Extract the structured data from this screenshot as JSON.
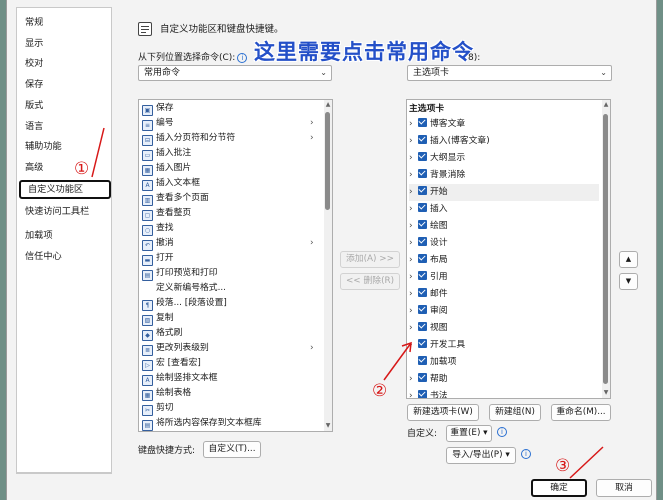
{
  "nav": {
    "items": [
      "常规",
      "显示",
      "校对",
      "保存",
      "版式",
      "语言",
      "辅助功能",
      "高级",
      "自定义功能区",
      "快速访问工具栏",
      "加载项",
      "信任中心"
    ],
    "selected_index": 8
  },
  "header": {
    "title": "自定义功能区和键盘快捷键。"
  },
  "annotation": {
    "banner": "这里需要点击常用命令",
    "mark1": "①",
    "mark2": "②",
    "mark3": "③",
    "color": "#d71818"
  },
  "left": {
    "label": "从下列位置选择命令(C):",
    "combo_value": "常用命令",
    "commands": [
      {
        "label": "保存",
        "icon": "save-icon",
        "arrow": false
      },
      {
        "label": "编号",
        "icon": "numbering-icon",
        "arrow": true
      },
      {
        "label": "插入分页符和分节符",
        "icon": "page-break-icon",
        "arrow": true
      },
      {
        "label": "插入批注",
        "icon": "comment-icon",
        "arrow": false
      },
      {
        "label": "插入图片",
        "icon": "picture-icon",
        "arrow": false
      },
      {
        "label": "插入文本框",
        "icon": "textbox-icon",
        "arrow": false
      },
      {
        "label": "查看多个页面",
        "icon": "multipage-icon",
        "arrow": false
      },
      {
        "label": "查看整页",
        "icon": "page-icon",
        "arrow": false
      },
      {
        "label": "查找",
        "icon": "search-icon",
        "arrow": false
      },
      {
        "label": "撤消",
        "icon": "undo-icon",
        "arrow": true
      },
      {
        "label": "打开",
        "icon": "open-folder-icon",
        "arrow": false
      },
      {
        "label": "打印预览和打印",
        "icon": "print-icon",
        "arrow": false
      },
      {
        "label": "定义新编号格式...",
        "icon": "",
        "arrow": false
      },
      {
        "label": "段落... [段落设置]",
        "icon": "paragraph-icon",
        "arrow": false
      },
      {
        "label": "复制",
        "icon": "copy-icon",
        "arrow": false
      },
      {
        "label": "格式刷",
        "icon": "format-painter-icon",
        "arrow": false
      },
      {
        "label": "更改列表级别",
        "icon": "list-level-icon",
        "arrow": true
      },
      {
        "label": "宏 [查看宏]",
        "icon": "macro-icon",
        "arrow": false
      },
      {
        "label": "绘制竖排文本框",
        "icon": "vertical-textbox-icon",
        "arrow": false
      },
      {
        "label": "绘制表格",
        "icon": "draw-table-icon",
        "arrow": false
      },
      {
        "label": "剪切",
        "icon": "cut-icon",
        "arrow": false
      },
      {
        "label": "将所选内容保存到文本框库",
        "icon": "save-selection-icon",
        "arrow": false
      }
    ],
    "shortcut_label": "键盘快捷方式:",
    "shortcut_button": "自定义(T)..."
  },
  "middle": {
    "add": "添加(A) >>",
    "remove": "<< 删除(R)"
  },
  "right": {
    "label": "8):",
    "combo_value": "主选项卡",
    "header": "主选项卡",
    "tabs": [
      {
        "label": "博客文章",
        "expand": true
      },
      {
        "label": "插入(博客文章)",
        "expand": true
      },
      {
        "label": "大纲显示",
        "expand": true
      },
      {
        "label": "背景消除",
        "expand": true
      },
      {
        "label": "开始",
        "expand": true
      },
      {
        "label": "插入",
        "expand": true
      },
      {
        "label": "绘图",
        "expand": true
      },
      {
        "label": "设计",
        "expand": true
      },
      {
        "label": "布局",
        "expand": true
      },
      {
        "label": "引用",
        "expand": true
      },
      {
        "label": "邮件",
        "expand": true
      },
      {
        "label": "审阅",
        "expand": true
      },
      {
        "label": "视图",
        "expand": true
      },
      {
        "label": "开发工具",
        "expand": true
      },
      {
        "label": "加载项",
        "expand": false
      },
      {
        "label": "帮助",
        "expand": true
      },
      {
        "label": "书法",
        "expand": true
      }
    ],
    "new_tab": "新建选项卡(W)",
    "new_group": "新建组(N)",
    "rename": "重命名(M)...",
    "custom_label": "自定义:",
    "reset": "重置(E) ▾",
    "import_export": "导入/导出(P) ▾"
  },
  "order": {
    "up": "▲",
    "down": "▼"
  },
  "footer": {
    "ok": "确定",
    "cancel": "取消"
  }
}
